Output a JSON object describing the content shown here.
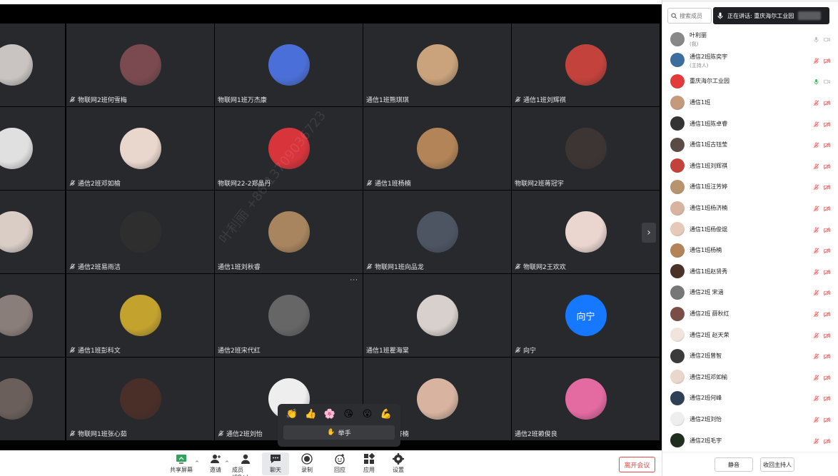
{
  "watermark": "叶利丽 +86 13709036723",
  "grid_tiles": [
    {
      "name": "",
      "muted": false,
      "avatar_color": "#c9c4c2"
    },
    {
      "name": "物联网2班何雪梅",
      "muted": true,
      "avatar_color": "#7b4a50"
    },
    {
      "name": "物联网1班万杰康",
      "muted": false,
      "avatar_color": "#4b6fd8"
    },
    {
      "name": "通信1班熊琪琪",
      "muted": false,
      "avatar_color": "#caa27c"
    },
    {
      "name": "通信1班刘辉祺",
      "muted": true,
      "avatar_color": "#c4423c"
    },
    {
      "name": "",
      "muted": false,
      "avatar_color": "#e0e0e0"
    },
    {
      "name": "通信2班邓如榆",
      "muted": true,
      "avatar_color": "#e9d6cc"
    },
    {
      "name": "物联网22-2郑晶丹",
      "muted": false,
      "avatar_color": "#d8343c"
    },
    {
      "name": "通信1班杨楠",
      "muted": true,
      "avatar_color": "#b38457"
    },
    {
      "name": "物联网2班蒋冠宇",
      "muted": false,
      "avatar_color": "#3d3533"
    },
    {
      "name": "",
      "muted": false,
      "avatar_color": "#d9cdc6"
    },
    {
      "name": "通信2班易雨洁",
      "muted": true,
      "avatar_color": "#2e2e2e"
    },
    {
      "name": "通信1班刘秋睿",
      "muted": false,
      "avatar_color": "#a8855e"
    },
    {
      "name": "物联网1班向品龙",
      "muted": true,
      "avatar_color": "#4d5563"
    },
    {
      "name": "物联网2王欢欢",
      "muted": true,
      "avatar_color": "#ead5cf"
    },
    {
      "name": "",
      "muted": false,
      "avatar_color": "#8a7e7a"
    },
    {
      "name": "通信1班彭科文",
      "muted": true,
      "avatar_color": "#c4a22e"
    },
    {
      "name": "通信2班宋代红",
      "muted": false,
      "avatar_color": "#666"
    },
    {
      "name": "通信1班瞿海棠",
      "muted": false,
      "avatar_color": "#d7d0cc"
    },
    {
      "name": "向宁",
      "muted": true,
      "avatar_color": "#1677ff",
      "letter": "向宁"
    },
    {
      "name": "",
      "muted": false,
      "avatar_color": "#6a5f5a"
    },
    {
      "name": "物联网1班张心茹",
      "muted": true,
      "avatar_color": "#4a2e28"
    },
    {
      "name": "通信2班刘怡",
      "muted": true,
      "avatar_color": "#eeeeee"
    },
    {
      "name": "通信1班杨济楠",
      "muted": false,
      "avatar_color": "#d7b3a0"
    },
    {
      "name": "通信2班赖俊良",
      "muted": false,
      "avatar_color": "#e46aa2"
    }
  ],
  "reactions": {
    "emojis": [
      "👏",
      "👍",
      "🌸",
      "😘",
      "😮",
      "💪"
    ],
    "raise_hand_icon": "✋",
    "raise_hand_label": "举手"
  },
  "toolbar": {
    "buttons": [
      {
        "label": "共享屏幕",
        "icon": "share-screen-icon"
      },
      {
        "label": "邀请",
        "icon": "invite-icon"
      },
      {
        "label": "成员(99+)",
        "icon": "members-icon"
      },
      {
        "label": "聊天",
        "icon": "chat-icon"
      },
      {
        "label": "录制",
        "icon": "record-icon"
      },
      {
        "label": "回应",
        "icon": "reaction-icon"
      },
      {
        "label": "应用",
        "icon": "apps-icon"
      },
      {
        "label": "设置",
        "icon": "settings-icon"
      }
    ],
    "leave_label": "离开会议"
  },
  "panel": {
    "search_placeholder": "搜索成员",
    "speaking_label": "正在讲话: 重庆海尔工业园",
    "members": [
      {
        "name": "叶利丽",
        "sub": "(我)",
        "color": "#888",
        "mic": "gray",
        "cam": "gray"
      },
      {
        "name": "通信2班陈奕宇",
        "sub": "(主持人)",
        "color": "#3b6e9e",
        "mic": "muted",
        "cam": "muted"
      },
      {
        "name": "重庆海尔工业园",
        "sub": "",
        "color": "#e23b3b",
        "mic": "active",
        "cam": "gray"
      },
      {
        "name": "通信1班",
        "sub": "",
        "color": "#c49a7c",
        "mic": "muted",
        "cam": "muted"
      },
      {
        "name": "通信1班陈卓睿",
        "sub": "",
        "color": "#333",
        "mic": "muted",
        "cam": "muted"
      },
      {
        "name": "通信1班古钰莹",
        "sub": "",
        "color": "#5a4b44",
        "mic": "muted",
        "cam": "muted"
      },
      {
        "name": "通信1班刘辉祺",
        "sub": "",
        "color": "#c4423c",
        "mic": "muted",
        "cam": "muted"
      },
      {
        "name": "通信1班汪芳婷",
        "sub": "",
        "color": "#b7946d",
        "mic": "muted",
        "cam": "muted"
      },
      {
        "name": "通信1班杨济楠",
        "sub": "",
        "color": "#d7b3a0",
        "mic": "muted",
        "cam": "muted"
      },
      {
        "name": "通信1班杨俊焜",
        "sub": "",
        "color": "#e5c9b9",
        "mic": "muted",
        "cam": "muted"
      },
      {
        "name": "通信1班杨楠",
        "sub": "",
        "color": "#b38457",
        "mic": "muted",
        "cam": "muted"
      },
      {
        "name": "通信1班赵贤秀",
        "sub": "",
        "color": "#4a3326",
        "mic": "muted",
        "cam": "muted"
      },
      {
        "name": "通信2班 宋涵",
        "sub": "",
        "color": "#777",
        "mic": "muted",
        "cam": "muted"
      },
      {
        "name": "通信2班 薛秋红",
        "sub": "",
        "color": "#7a4e46",
        "mic": "muted",
        "cam": "muted"
      },
      {
        "name": "通信2班 赵天荣",
        "sub": "",
        "color": "#f1e4dc",
        "mic": "muted",
        "cam": "muted"
      },
      {
        "name": "通信2班曾智",
        "sub": "",
        "color": "#3a3a3a",
        "mic": "muted",
        "cam": "muted"
      },
      {
        "name": "通信2班邓如榆",
        "sub": "",
        "color": "#e9d6cc",
        "mic": "muted",
        "cam": "muted"
      },
      {
        "name": "通信2班何峰",
        "sub": "",
        "color": "#2f3f55",
        "mic": "muted",
        "cam": "muted"
      },
      {
        "name": "通信2班刘怡",
        "sub": "",
        "color": "#eeeeee",
        "mic": "muted",
        "cam": "muted"
      },
      {
        "name": "通信2班毛宇",
        "sub": "",
        "color": "#1f2e1f",
        "mic": "muted",
        "cam": "muted"
      }
    ],
    "mute_all_label": "静音",
    "reclaim_host_label": "收回主持人"
  }
}
